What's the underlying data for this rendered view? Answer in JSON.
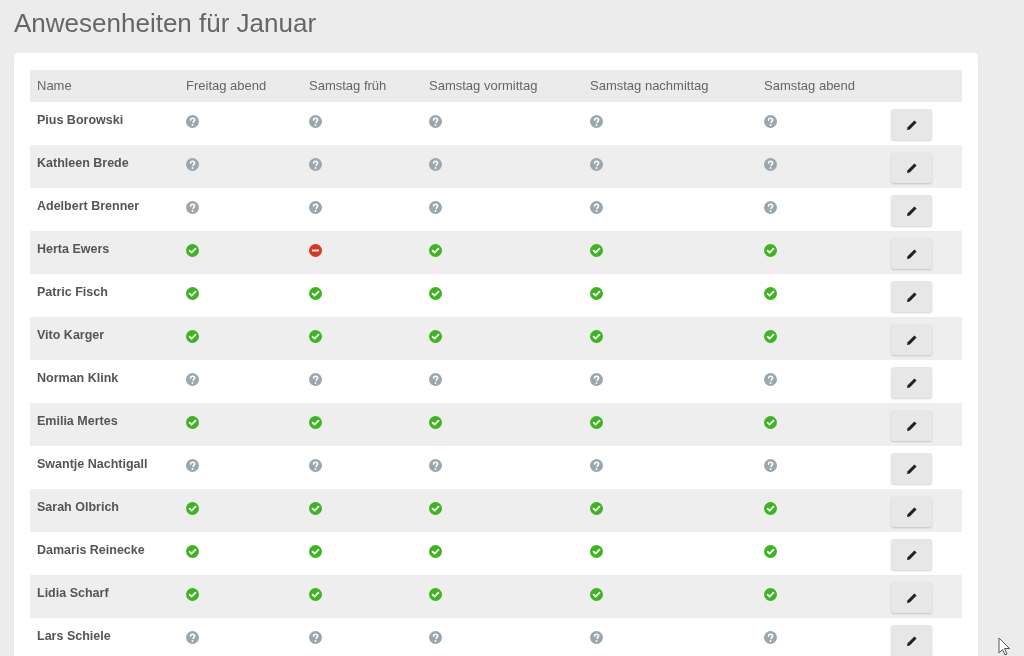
{
  "page_title": "Anwesenheiten für Januar",
  "table": {
    "columns": [
      "Name",
      "Freitag abend",
      "Samstag früh",
      "Samstag vormittag",
      "Samstag nachmittag",
      "Samstag abend"
    ],
    "rows": [
      {
        "name": "Pius Borowski",
        "attendance": [
          {
            "kind": "unknown"
          },
          {
            "kind": "unknown"
          },
          {
            "kind": "unknown"
          },
          {
            "kind": "unknown"
          },
          {
            "kind": "unknown"
          }
        ]
      },
      {
        "name": "Kathleen Brede",
        "attendance": [
          {
            "kind": "unknown"
          },
          {
            "kind": "unknown"
          },
          {
            "kind": "unknown"
          },
          {
            "kind": "unknown"
          },
          {
            "kind": "unknown"
          }
        ]
      },
      {
        "name": "Adelbert Brenner",
        "attendance": [
          {
            "kind": "unknown"
          },
          {
            "kind": "unknown"
          },
          {
            "kind": "unknown"
          },
          {
            "kind": "unknown"
          },
          {
            "kind": "unknown"
          }
        ]
      },
      {
        "name": "Herta Ewers",
        "attendance": [
          {
            "kind": "yes"
          },
          {
            "kind": "no"
          },
          {
            "kind": "yes"
          },
          {
            "kind": "yes"
          },
          {
            "kind": "yes"
          }
        ]
      },
      {
        "name": "Patric Fisch",
        "attendance": [
          {
            "kind": "yes"
          },
          {
            "kind": "yes"
          },
          {
            "kind": "yes"
          },
          {
            "kind": "yes"
          },
          {
            "kind": "yes"
          }
        ]
      },
      {
        "name": "Vito Karger",
        "attendance": [
          {
            "kind": "yes"
          },
          {
            "kind": "yes"
          },
          {
            "kind": "yes"
          },
          {
            "kind": "yes"
          },
          {
            "kind": "yes"
          }
        ]
      },
      {
        "name": "Norman Klink",
        "attendance": [
          {
            "kind": "unknown"
          },
          {
            "kind": "unknown"
          },
          {
            "kind": "unknown"
          },
          {
            "kind": "unknown"
          },
          {
            "kind": "unknown"
          }
        ]
      },
      {
        "name": "Emilia Mertes",
        "attendance": [
          {
            "kind": "yes"
          },
          {
            "kind": "yes"
          },
          {
            "kind": "yes"
          },
          {
            "kind": "yes"
          },
          {
            "kind": "yes"
          }
        ]
      },
      {
        "name": "Swantje Nachtigall",
        "attendance": [
          {
            "kind": "unknown"
          },
          {
            "kind": "unknown"
          },
          {
            "kind": "unknown"
          },
          {
            "kind": "unknown"
          },
          {
            "kind": "unknown"
          }
        ]
      },
      {
        "name": "Sarah Olbrich",
        "attendance": [
          {
            "kind": "yes"
          },
          {
            "kind": "yes"
          },
          {
            "kind": "yes"
          },
          {
            "kind": "yes"
          },
          {
            "kind": "yes"
          }
        ]
      },
      {
        "name": "Damaris Reinecke",
        "attendance": [
          {
            "kind": "yes"
          },
          {
            "kind": "yes"
          },
          {
            "kind": "yes"
          },
          {
            "kind": "yes"
          },
          {
            "kind": "yes"
          }
        ]
      },
      {
        "name": "Lidia Scharf",
        "attendance": [
          {
            "kind": "yes"
          },
          {
            "kind": "yes"
          },
          {
            "kind": "yes"
          },
          {
            "kind": "yes"
          },
          {
            "kind": "yes"
          }
        ]
      },
      {
        "name": "Lars Schiele",
        "attendance": [
          {
            "kind": "unknown"
          },
          {
            "kind": "unknown"
          },
          {
            "kind": "unknown"
          },
          {
            "kind": "unknown"
          },
          {
            "kind": "unknown"
          }
        ]
      }
    ]
  }
}
